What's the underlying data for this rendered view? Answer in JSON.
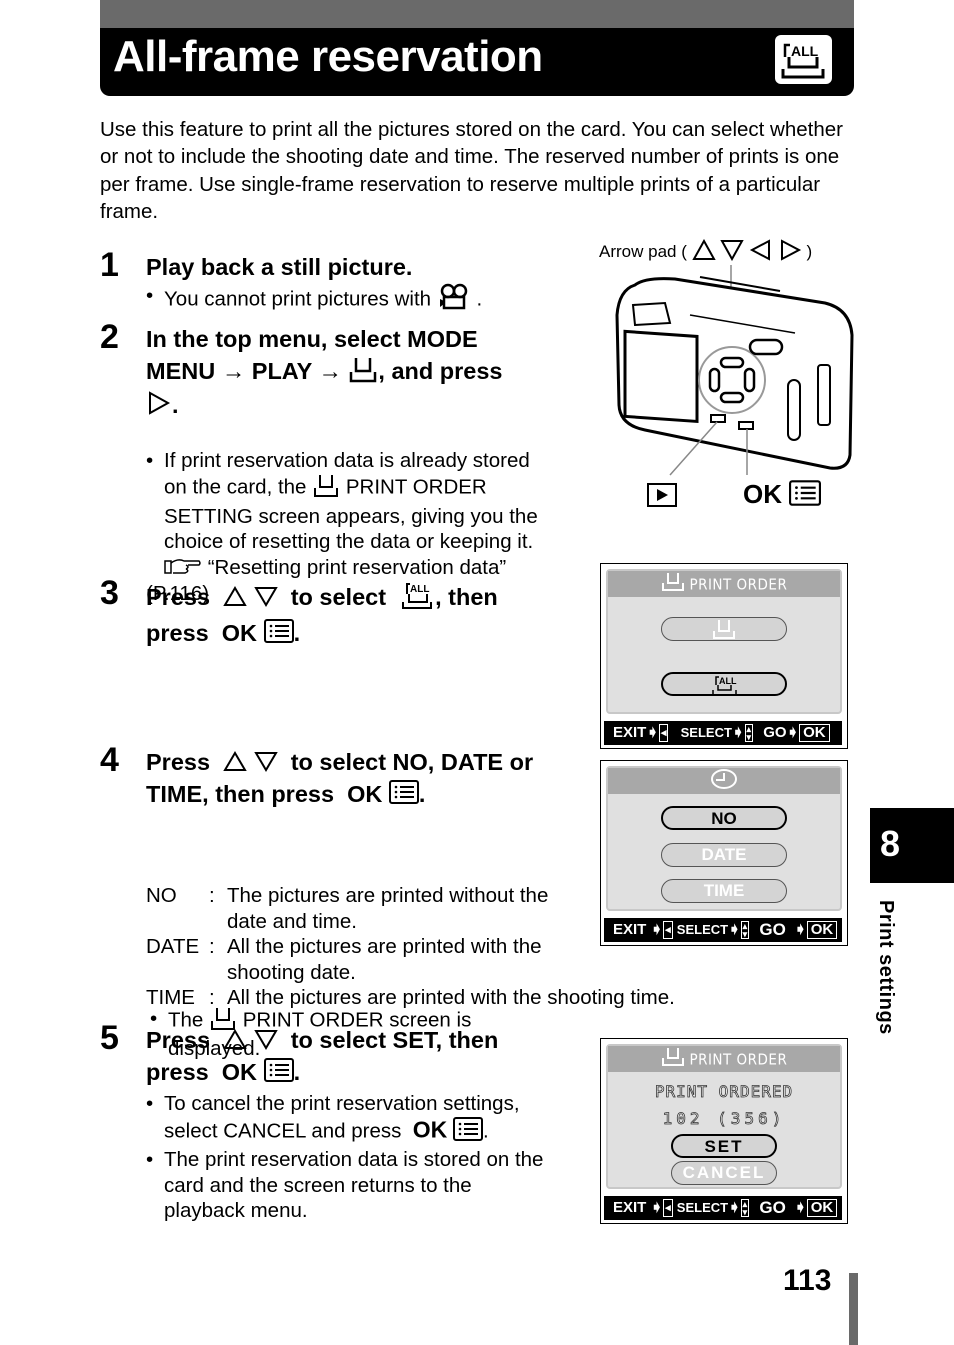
{
  "header": {
    "title": "All-frame reservation",
    "icon": "all-frame-print-icon",
    "icon_label": "ALL"
  },
  "intro": "Use this feature to print all the pictures stored on the card. You can select whether or not to include the shooting date and time. The reserved number of prints is one per frame. Use single-frame reservation to reserve multiple prints of a particular frame.",
  "steps": [
    {
      "number": "1",
      "heading": "Play back a still picture.",
      "bullets": [
        {
          "before": "You cannot print pictures with",
          "icon": "movie-camera-icon",
          "after": "."
        }
      ]
    },
    {
      "number": "2",
      "heading_line1": "In the top menu, select MODE",
      "heading_line2_a": "MENU",
      "heading_line2_b": "PLAY",
      "heading_line2_c": ", and press",
      "arrow": "→",
      "icon": "print-order-icon",
      "press_icon": "right-arrow-icon",
      "bullet_lines": [
        "If print reservation data is already stored",
        "on the card, the",
        "PRINT ORDER",
        "SETTING screen appears, giving you the",
        "choice of resetting the data or keeping it.",
        "“Resetting print reservation data”",
        "(P.116)"
      ],
      "ref_icon": "reference-hand-icon"
    },
    {
      "number": "3",
      "heading_a": "Press",
      "heading_b": "to select",
      "heading_c": ", then",
      "heading_d": "press",
      "ok": "OK"
    },
    {
      "number": "4",
      "heading_a": "Press",
      "heading_b": "to select NO, DATE or",
      "heading_c": "TIME, then press",
      "ok": "OK",
      "bullet_a": "The",
      "bullet_b": "PRINT ORDER screen is",
      "bullet_c": "displayed.",
      "definitions": [
        {
          "term": "NO",
          "lines": [
            "The pictures are printed without the",
            "date and time."
          ]
        },
        {
          "term": "DATE",
          "lines": [
            "All the pictures are printed with the",
            "shooting date."
          ]
        },
        {
          "term": "TIME",
          "lines": [
            "All the pictures are printed with the shooting time."
          ]
        }
      ]
    },
    {
      "number": "5",
      "heading_a": "Press",
      "heading_b": "to select SET, then",
      "heading_c": "press",
      "ok": "OK",
      "bullet1_a": "To cancel the print reservation settings,",
      "bullet1_b": "select CANCEL and press",
      "bullet2": [
        "The print reservation data is stored on the",
        "card and the screen returns to the",
        "playback menu."
      ]
    }
  ],
  "camera_figure": {
    "arrow_pad_label": "Arrow pad (",
    "arrow_pad_close": ")",
    "play_button_icon": "playback-icon",
    "ok_label": "OK",
    "menu_icon": "menu-list-icon"
  },
  "screens": {
    "screen1": {
      "title": "PRINT ORDER",
      "options": [
        "single-frame",
        "all-frame"
      ],
      "selected": 1,
      "footer": {
        "exit": "EXIT",
        "select": "SELECT",
        "go": "GO",
        "ok": "OK"
      }
    },
    "screen2": {
      "title_icon": "clock-icon",
      "options": [
        "NO",
        "DATE",
        "TIME"
      ],
      "selected": 0,
      "footer": {
        "exit": "EXIT",
        "select": "SELECT",
        "go": "GO",
        "ok": "OK"
      }
    },
    "screen3": {
      "title": "PRINT ORDER",
      "line1": "PRINT ORDERED",
      "line2": "102 (356)",
      "options": [
        "SET",
        "CANCEL"
      ],
      "selected": 0,
      "footer": {
        "exit": "EXIT",
        "select": "SELECT",
        "go": "GO",
        "ok": "OK"
      }
    }
  },
  "side_tab": {
    "chapter": "8",
    "label": "Print settings"
  },
  "page_number": "113"
}
